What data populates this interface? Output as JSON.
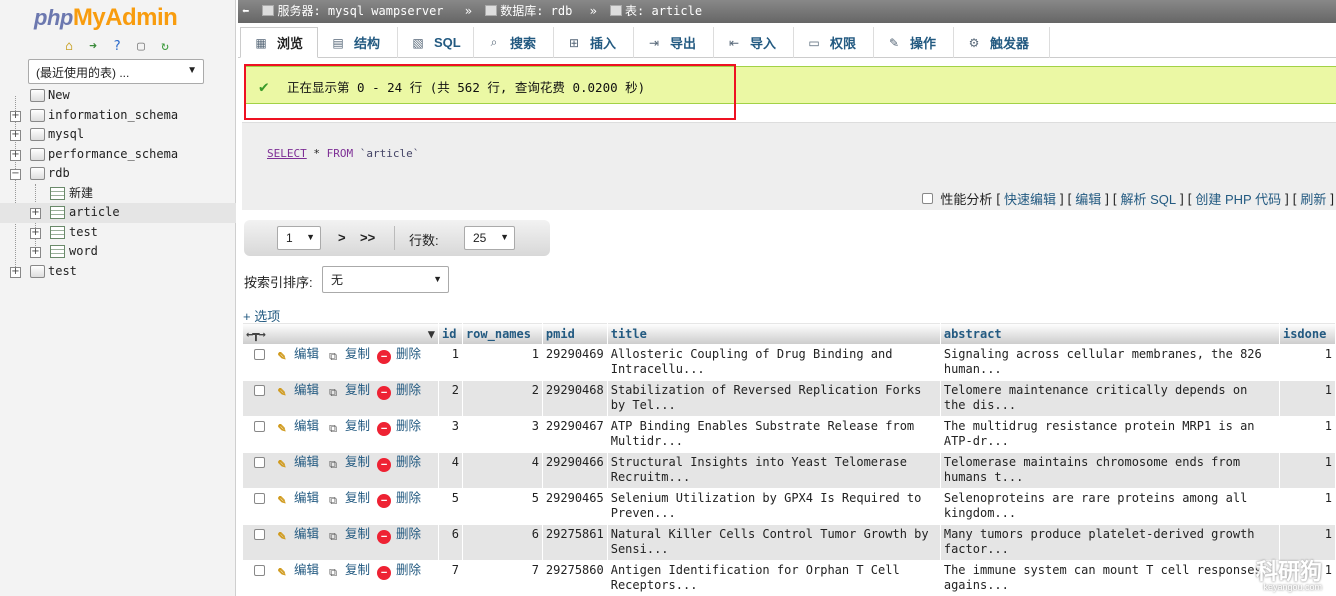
{
  "nav": {
    "logo": {
      "php": "php",
      "myadmin": "MyAdmin"
    },
    "recent_select": "(最近使用的表) ...",
    "tree": [
      {
        "label": "New",
        "level": 0,
        "kind": "new"
      },
      {
        "label": "information_schema",
        "level": 0,
        "kind": "db"
      },
      {
        "label": "mysql",
        "level": 0,
        "kind": "db"
      },
      {
        "label": "performance_schema",
        "level": 0,
        "kind": "db"
      },
      {
        "label": "rdb",
        "level": 0,
        "kind": "db-open"
      },
      {
        "label": "新建",
        "level": 1,
        "kind": "new"
      },
      {
        "label": "article",
        "level": 1,
        "kind": "table"
      },
      {
        "label": "test",
        "level": 1,
        "kind": "table"
      },
      {
        "label": "word",
        "level": 1,
        "kind": "table"
      },
      {
        "label": "test",
        "level": 0,
        "kind": "db"
      }
    ]
  },
  "breadcrumb": {
    "server": "服务器: mysql wampserver",
    "database": "数据库: rdb",
    "table": "表: article"
  },
  "tabs": [
    "浏览",
    "结构",
    "SQL",
    "搜索",
    "插入",
    "导出",
    "导入",
    "权限",
    "操作",
    "触发器"
  ],
  "message": "正在显示第 0 - 24 行 (共 562 行, 查询花费 0.0200 秒)",
  "sql": {
    "select": "SELECT",
    "star": "*",
    "from": "FROM",
    "table": "`article`"
  },
  "query_links": {
    "profiling": "性能分析",
    "quick_edit": "快速编辑",
    "edit": "编辑",
    "explain": "解析 SQL",
    "create_php": "创建 PHP 代码",
    "refresh": "刷新"
  },
  "pager": {
    "page": "1",
    "next": ">",
    "last": ">>",
    "rows_label": "行数:",
    "rows_value": "25"
  },
  "sort": {
    "label": "按索引排序:",
    "value": "无"
  },
  "options_label": "+ 选项",
  "grid": {
    "columns": [
      "id",
      "row_names",
      "pmid",
      "title",
      "abstract",
      "isdone"
    ],
    "action_labels": {
      "edit": "编辑",
      "copy": "复制",
      "delete": "删除"
    },
    "rows": [
      {
        "id": "1",
        "row_names": "1",
        "pmid": "29290469",
        "title": "Allosteric Coupling of Drug Binding and Intracellu...",
        "abstract": "Signaling across cellular membranes, the 826 human...",
        "isdone": "1"
      },
      {
        "id": "2",
        "row_names": "2",
        "pmid": "29290468",
        "title": "Stabilization of Reversed Replication Forks by Tel...",
        "abstract": "Telomere maintenance critically depends on the dis...",
        "isdone": "1"
      },
      {
        "id": "3",
        "row_names": "3",
        "pmid": "29290467",
        "title": "ATP Binding Enables Substrate Release from Multidr...",
        "abstract": "The multidrug resistance protein MRP1 is an ATP-dr...",
        "isdone": "1"
      },
      {
        "id": "4",
        "row_names": "4",
        "pmid": "29290466",
        "title": "Structural Insights into Yeast Telomerase Recruitm...",
        "abstract": "Telomerase maintains chromosome ends from humans t...",
        "isdone": "1"
      },
      {
        "id": "5",
        "row_names": "5",
        "pmid": "29290465",
        "title": "Selenium Utilization by GPX4 Is Required to Preven...",
        "abstract": "Selenoproteins are rare proteins among all kingdom...",
        "isdone": "1"
      },
      {
        "id": "6",
        "row_names": "6",
        "pmid": "29275861",
        "title": "Natural Killer Cells Control Tumor Growth by Sensi...",
        "abstract": "Many tumors produce platelet-derived growth factor...",
        "isdone": "1"
      },
      {
        "id": "7",
        "row_names": "7",
        "pmid": "29275860",
        "title": "Antigen Identification for Orphan T Cell Receptors...",
        "abstract": "The immune system can mount T  cell responses agains...",
        "isdone": "1"
      }
    ]
  },
  "watermark": {
    "main": "科研狗",
    "sub": "keyangou.com"
  }
}
